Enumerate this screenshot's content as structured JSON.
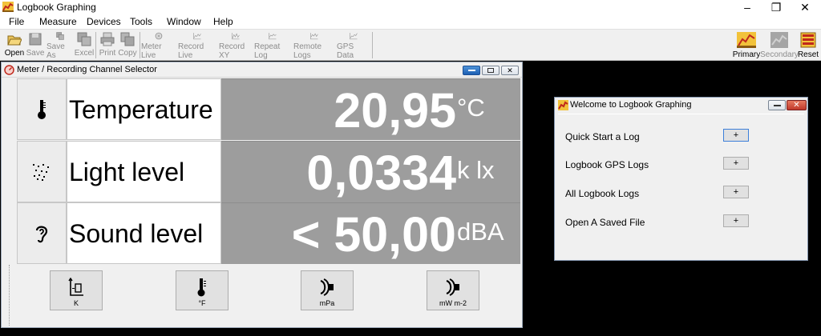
{
  "app": {
    "title": "Logbook Graphing"
  },
  "menu": [
    "File",
    "Measure",
    "Devices",
    "Tools",
    "Window",
    "Help"
  ],
  "toolbar": {
    "open": "Open",
    "save": "Save",
    "save_as": "Save As",
    "excel": "Excel",
    "print": "Print",
    "copy": "Copy",
    "meter_live": "Meter Live",
    "record_live": "Record Live",
    "record_xy": "Record XY",
    "repeat_log": "Repeat Log",
    "remote_logs": "Remote Logs",
    "gps_data": "GPS Data",
    "primary": "Primary",
    "secondary": "Secondary",
    "reset": "Reset"
  },
  "meter_window": {
    "title": "Meter / Recording Channel Selector",
    "rows": [
      {
        "icon": "thermometer-icon",
        "label": "Temperature",
        "value": "20,95",
        "unit": "°C"
      },
      {
        "icon": "light-sensor-icon",
        "label": "Light level",
        "value": "0,0334",
        "unit": "k lx"
      },
      {
        "icon": "ear-icon",
        "label": "Sound level",
        "value": "< 50,00",
        "unit": "dBA"
      }
    ],
    "unit_buttons": [
      "K",
      "°F",
      "mPa",
      "mW m-2"
    ]
  },
  "welcome": {
    "title": "Welcome to Logbook Graphing",
    "items": [
      {
        "label": "Quick Start a Log",
        "button": "+"
      },
      {
        "label": "Logbook GPS Logs",
        "button": "+"
      },
      {
        "label": "All Logbook Logs",
        "button": "+"
      },
      {
        "label": "Open A Saved File",
        "button": "+"
      }
    ]
  },
  "colors": {
    "value_panel": "#9d9d9d",
    "value_text": "#ffffff",
    "background": "#000000"
  }
}
